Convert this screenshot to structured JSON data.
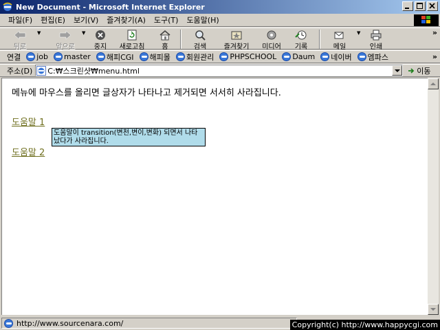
{
  "window": {
    "title": "New Document - Microsoft Internet Explorer"
  },
  "menu": [
    "파일(F)",
    "편집(E)",
    "보기(V)",
    "즐겨찾기(A)",
    "도구(T)",
    "도움말(H)"
  ],
  "toolbar": {
    "back": "뒤로",
    "forward": "앞으로",
    "stop": "중지",
    "refresh": "새로고침",
    "home": "홈",
    "search": "검색",
    "favorites": "즐겨찾기",
    "media": "미디어",
    "history": "기록",
    "mail": "메일",
    "print": "인쇄"
  },
  "links": {
    "label": "연결",
    "items": [
      "job",
      "master",
      "해피CGI",
      "해피몰",
      "회원관리",
      "PHPSCHOOL",
      "Daum",
      "네이버",
      "엠파스"
    ]
  },
  "address": {
    "label": "주소(D)",
    "value": "C:₩스크린샷₩menu.html",
    "go": "이동"
  },
  "page": {
    "intro": "메뉴에 마우스를 올리면 글상자가 나타나고 제거되면 서서히 사라집니다.",
    "help1": "도움말 1",
    "help2": "도움말 2",
    "tooltip": "도움말이 transition(변천,변이,변화) 되면서 나타났다가 사라집니다."
  },
  "status": {
    "url": "http://www.sourcenara.com/",
    "copyright": "Copyright(c) http://www.happycgi.com"
  },
  "colors": {
    "titlebar_start": "#0a246a",
    "titlebar_end": "#a6caf0",
    "chrome": "#d4d0c8",
    "tooltip_bg": "#b0dcea",
    "link": "#707020"
  }
}
